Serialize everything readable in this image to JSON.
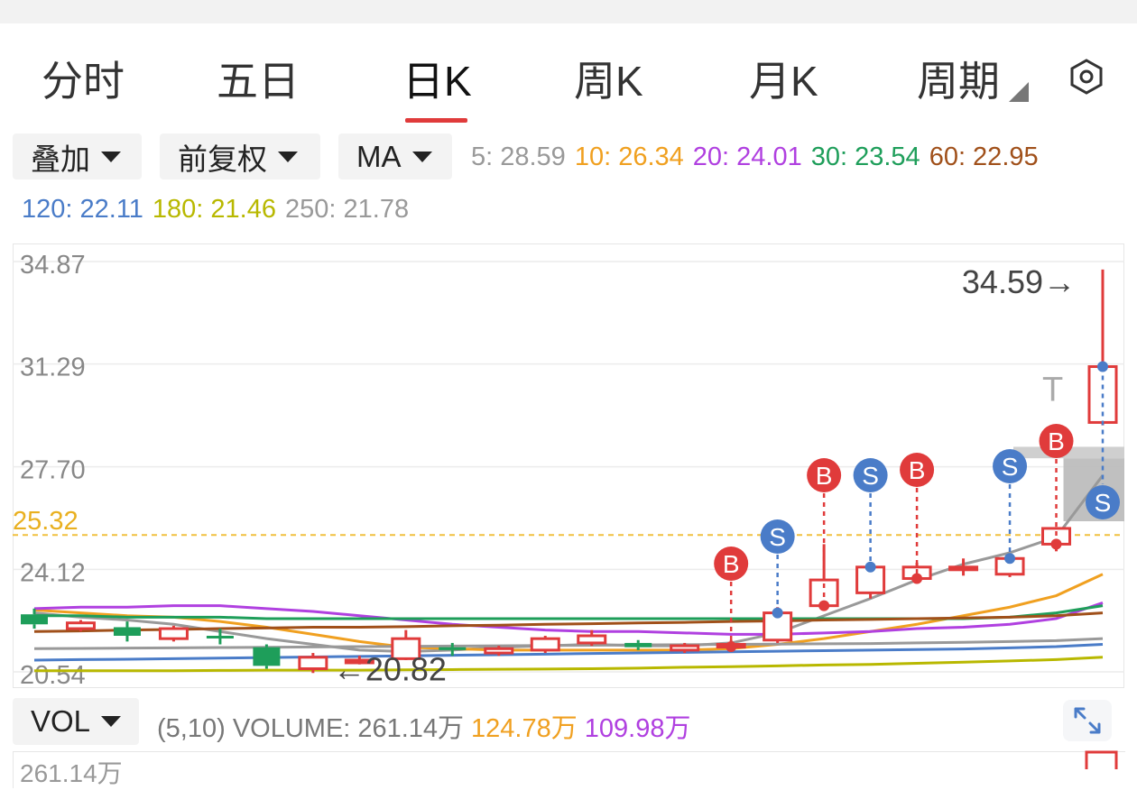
{
  "tabs": [
    {
      "label": "分时",
      "active": false
    },
    {
      "label": "五日",
      "active": false
    },
    {
      "label": "日K",
      "active": true
    },
    {
      "label": "周K",
      "active": false
    },
    {
      "label": "月K",
      "active": false
    },
    {
      "label": "周期",
      "active": false
    }
  ],
  "settings_icon": "hexagon-settings-icon",
  "controls": {
    "overlay": "叠加",
    "adjust": "前复权",
    "indicator": "MA"
  },
  "ma": [
    {
      "label": "5: 28.59",
      "color": "#999999"
    },
    {
      "label": "10: 26.34",
      "color": "#f0a020"
    },
    {
      "label": "20: 24.01",
      "color": "#b040e0"
    },
    {
      "label": "30: 23.54",
      "color": "#1e9e5a"
    },
    {
      "label": "60: 22.95",
      "color": "#a0501a"
    },
    {
      "label": "120: 22.11",
      "color": "#4a7cc8"
    },
    {
      "label": "180: 21.46",
      "color": "#b8b800"
    },
    {
      "label": "250: 21.78",
      "color": "#999999"
    }
  ],
  "chart_data": {
    "type": "candlestick",
    "y_axis_labels": [
      "34.87",
      "31.29",
      "27.70",
      "24.12",
      "20.54"
    ],
    "ref_line": {
      "label": "25.32",
      "value": 25.32,
      "color": "#f0c040"
    },
    "max_label": "34.59→",
    "min_label": "←20.82",
    "ylim": [
      20.54,
      34.87
    ],
    "up_color": "#e03b3b",
    "down_color": "#1e9e5a",
    "candles": [
      {
        "o": 22.55,
        "c": 22.2,
        "h": 22.75,
        "l": 22.05
      },
      {
        "o": 22.05,
        "c": 22.25,
        "h": 22.35,
        "l": 21.95
      },
      {
        "o": 22.1,
        "c": 21.8,
        "h": 22.3,
        "l": 21.6
      },
      {
        "o": 21.7,
        "c": 22.05,
        "h": 22.15,
        "l": 21.6
      },
      {
        "o": 21.8,
        "c": 21.75,
        "h": 22.05,
        "l": 21.5
      },
      {
        "o": 21.4,
        "c": 20.75,
        "h": 21.5,
        "l": 20.65
      },
      {
        "o": 20.65,
        "c": 21.05,
        "h": 21.2,
        "l": 20.5
      },
      {
        "o": 20.9,
        "c": 20.95,
        "h": 21.1,
        "l": 20.8
      },
      {
        "o": 21.0,
        "c": 21.7,
        "h": 22.0,
        "l": 20.95
      },
      {
        "o": 21.4,
        "c": 21.3,
        "h": 21.55,
        "l": 21.1
      },
      {
        "o": 21.2,
        "c": 21.35,
        "h": 21.45,
        "l": 21.1
      },
      {
        "o": 21.3,
        "c": 21.7,
        "h": 21.8,
        "l": 21.2
      },
      {
        "o": 21.55,
        "c": 21.8,
        "h": 22.0,
        "l": 21.45
      },
      {
        "o": 21.55,
        "c": 21.4,
        "h": 21.65,
        "l": 21.3
      },
      {
        "o": 21.3,
        "c": 21.45,
        "h": 21.55,
        "l": 21.2
      },
      {
        "o": 21.5,
        "c": 21.5,
        "h": 21.65,
        "l": 21.35
      },
      {
        "o": 21.65,
        "c": 22.6,
        "h": 22.8,
        "l": 21.55
      },
      {
        "o": 22.85,
        "c": 23.75,
        "h": 25.0,
        "l": 22.75
      },
      {
        "o": 23.3,
        "c": 24.2,
        "h": 24.25,
        "l": 23.1
      },
      {
        "o": 23.8,
        "c": 24.2,
        "h": 24.35,
        "l": 23.75
      },
      {
        "o": 24.2,
        "c": 24.2,
        "h": 24.5,
        "l": 23.9
      },
      {
        "o": 23.95,
        "c": 24.5,
        "h": 24.6,
        "l": 23.85
      },
      {
        "o": 25.0,
        "c": 25.55,
        "h": 25.6,
        "l": 24.75
      },
      {
        "o": 29.25,
        "c": 31.2,
        "h": 34.59,
        "l": 29.15
      }
    ],
    "ma_lines": [
      {
        "name": "5",
        "color": "#999999",
        "values": [
          22.6,
          22.45,
          22.35,
          22.2,
          21.95,
          21.7,
          21.5,
          21.3,
          21.25,
          21.3,
          21.4,
          21.45,
          21.5,
          21.45,
          21.45,
          21.55,
          21.9,
          22.5,
          23.1,
          23.75,
          24.3,
          24.7,
          25.25,
          27.4
        ]
      },
      {
        "name": "10",
        "color": "#f0a020",
        "values": [
          22.7,
          22.6,
          22.5,
          22.45,
          22.3,
          22.1,
          21.85,
          21.6,
          21.4,
          21.35,
          21.3,
          21.3,
          21.3,
          21.3,
          21.3,
          21.35,
          21.5,
          21.7,
          21.95,
          22.2,
          22.5,
          22.8,
          23.2,
          23.95
        ]
      },
      {
        "name": "20",
        "color": "#b040e0",
        "values": [
          22.75,
          22.8,
          22.8,
          22.85,
          22.85,
          22.75,
          22.65,
          22.5,
          22.35,
          22.2,
          22.1,
          22.0,
          21.95,
          21.95,
          21.9,
          21.85,
          21.85,
          21.9,
          21.95,
          22.05,
          22.1,
          22.2,
          22.4,
          22.95
        ]
      },
      {
        "name": "30",
        "color": "#1e9e5a",
        "values": [
          22.5,
          22.5,
          22.45,
          22.45,
          22.45,
          22.4,
          22.4,
          22.4,
          22.4,
          22.4,
          22.4,
          22.4,
          22.4,
          22.4,
          22.4,
          22.4,
          22.4,
          22.4,
          22.4,
          22.4,
          22.4,
          22.45,
          22.6,
          22.85
        ]
      },
      {
        "name": "60",
        "color": "#a0501a",
        "values": [
          21.95,
          21.97,
          22.0,
          22.02,
          22.05,
          22.07,
          22.1,
          22.1,
          22.12,
          22.15,
          22.17,
          22.2,
          22.22,
          22.25,
          22.27,
          22.3,
          22.32,
          22.35,
          22.37,
          22.4,
          22.42,
          22.45,
          22.5,
          22.6
        ]
      },
      {
        "name": "120",
        "color": "#4a7cc8",
        "values": [
          20.95,
          20.97,
          20.98,
          21.0,
          21.02,
          21.04,
          21.06,
          21.08,
          21.1,
          21.12,
          21.14,
          21.16,
          21.18,
          21.2,
          21.22,
          21.24,
          21.26,
          21.28,
          21.3,
          21.32,
          21.34,
          21.38,
          21.42,
          21.5
        ]
      },
      {
        "name": "180",
        "color": "#b8b800",
        "values": [
          20.58,
          20.58,
          20.58,
          20.58,
          20.59,
          20.6,
          20.6,
          20.6,
          20.61,
          20.62,
          20.63,
          20.64,
          20.65,
          20.67,
          20.7,
          20.72,
          20.75,
          20.78,
          20.8,
          20.84,
          20.88,
          20.92,
          20.97,
          21.05
        ]
      },
      {
        "name": "250",
        "color": "#999999",
        "values": [
          21.35,
          21.36,
          21.37,
          21.38,
          21.39,
          21.4,
          21.41,
          21.42,
          21.43,
          21.44,
          21.45,
          21.46,
          21.47,
          21.48,
          21.49,
          21.5,
          21.51,
          21.52,
          21.53,
          21.55,
          21.57,
          21.6,
          21.63,
          21.7
        ]
      }
    ],
    "signals": [
      {
        "type": "B",
        "index": 15,
        "value": 21.42
      },
      {
        "type": "S",
        "index": 16,
        "value": 22.6
      },
      {
        "type": "B",
        "index": 17,
        "value": 22.85
      },
      {
        "type": "S",
        "index": 18,
        "value": 24.2
      },
      {
        "type": "B",
        "index": 19,
        "value": 23.8
      },
      {
        "type": "S",
        "index": 21,
        "value": 24.5
      },
      {
        "type": "B",
        "index": 22,
        "value": 25.0
      },
      {
        "type": "S",
        "index": 23,
        "value": 31.2
      }
    ],
    "annotation_t": "T"
  },
  "volume": {
    "selector": "VOL",
    "params": "(5,10) VOLUME:",
    "volume": "261.14万",
    "ma5": "124.78万",
    "ma10": "109.98万",
    "axis_label": "261.14万"
  },
  "expand_icon": "expand-arrows-icon"
}
